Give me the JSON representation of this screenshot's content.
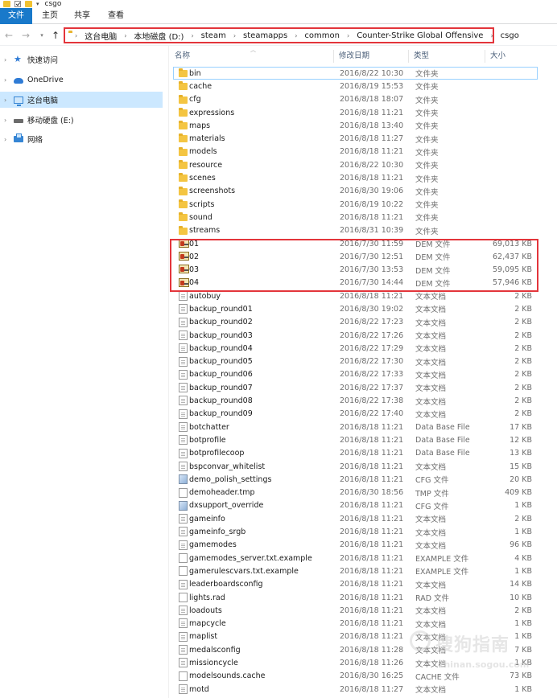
{
  "window": {
    "title": "csgo"
  },
  "ribbon": {
    "tabs": [
      "文件",
      "主页",
      "共享",
      "查看"
    ]
  },
  "address": {
    "crumbs": [
      "这台电脑",
      "本地磁盘 (D:)",
      "steam",
      "steamapps",
      "common",
      "Counter-Strike Global Offensive",
      "csgo"
    ]
  },
  "sidebar": {
    "items": [
      {
        "label": "快速访问",
        "icon": "quick-access-star-icon"
      },
      {
        "label": "OneDrive",
        "icon": "onedrive-cloud-icon"
      },
      {
        "label": "这台电脑",
        "icon": "this-pc-icon",
        "selected": true
      },
      {
        "label": "移动硬盘 (E:)",
        "icon": "removable-drive-icon"
      },
      {
        "label": "网络",
        "icon": "network-icon"
      }
    ]
  },
  "columns": {
    "name": "名称",
    "date": "修改日期",
    "type": "类型",
    "size": "大小"
  },
  "files": [
    {
      "name": "bin",
      "date": "2016/8/22 10:30",
      "type": "文件夹",
      "size": "",
      "icon": "folder"
    },
    {
      "name": "cache",
      "date": "2016/8/19 15:53",
      "type": "文件夹",
      "size": "",
      "icon": "folder"
    },
    {
      "name": "cfg",
      "date": "2016/8/18 18:07",
      "type": "文件夹",
      "size": "",
      "icon": "folder"
    },
    {
      "name": "expressions",
      "date": "2016/8/18 11:21",
      "type": "文件夹",
      "size": "",
      "icon": "folder"
    },
    {
      "name": "maps",
      "date": "2016/8/18 13:40",
      "type": "文件夹",
      "size": "",
      "icon": "folder"
    },
    {
      "name": "materials",
      "date": "2016/8/18 11:27",
      "type": "文件夹",
      "size": "",
      "icon": "folder"
    },
    {
      "name": "models",
      "date": "2016/8/18 11:21",
      "type": "文件夹",
      "size": "",
      "icon": "folder"
    },
    {
      "name": "resource",
      "date": "2016/8/22 10:30",
      "type": "文件夹",
      "size": "",
      "icon": "folder"
    },
    {
      "name": "scenes",
      "date": "2016/8/18 11:21",
      "type": "文件夹",
      "size": "",
      "icon": "folder"
    },
    {
      "name": "screenshots",
      "date": "2016/8/30 19:06",
      "type": "文件夹",
      "size": "",
      "icon": "folder"
    },
    {
      "name": "scripts",
      "date": "2016/8/19 10:22",
      "type": "文件夹",
      "size": "",
      "icon": "folder"
    },
    {
      "name": "sound",
      "date": "2016/8/18 11:21",
      "type": "文件夹",
      "size": "",
      "icon": "folder"
    },
    {
      "name": "streams",
      "date": "2016/8/31 10:39",
      "type": "文件夹",
      "size": "",
      "icon": "folder"
    },
    {
      "name": "01",
      "date": "2016/7/30 11:59",
      "type": "DEM 文件",
      "size": "69,013 KB",
      "icon": "dem"
    },
    {
      "name": "02",
      "date": "2016/7/30 12:51",
      "type": "DEM 文件",
      "size": "62,437 KB",
      "icon": "dem"
    },
    {
      "name": "03",
      "date": "2016/7/30 13:53",
      "type": "DEM 文件",
      "size": "59,095 KB",
      "icon": "dem"
    },
    {
      "name": "04",
      "date": "2016/7/30 14:44",
      "type": "DEM 文件",
      "size": "57,946 KB",
      "icon": "dem"
    },
    {
      "name": "autobuy",
      "date": "2016/8/18 11:21",
      "type": "文本文档",
      "size": "2 KB",
      "icon": "file"
    },
    {
      "name": "backup_round01",
      "date": "2016/8/30 19:02",
      "type": "文本文档",
      "size": "2 KB",
      "icon": "file"
    },
    {
      "name": "backup_round02",
      "date": "2016/8/22 17:23",
      "type": "文本文档",
      "size": "2 KB",
      "icon": "file"
    },
    {
      "name": "backup_round03",
      "date": "2016/8/22 17:26",
      "type": "文本文档",
      "size": "2 KB",
      "icon": "file"
    },
    {
      "name": "backup_round04",
      "date": "2016/8/22 17:29",
      "type": "文本文档",
      "size": "2 KB",
      "icon": "file"
    },
    {
      "name": "backup_round05",
      "date": "2016/8/22 17:30",
      "type": "文本文档",
      "size": "2 KB",
      "icon": "file"
    },
    {
      "name": "backup_round06",
      "date": "2016/8/22 17:33",
      "type": "文本文档",
      "size": "2 KB",
      "icon": "file"
    },
    {
      "name": "backup_round07",
      "date": "2016/8/22 17:37",
      "type": "文本文档",
      "size": "2 KB",
      "icon": "file"
    },
    {
      "name": "backup_round08",
      "date": "2016/8/22 17:38",
      "type": "文本文档",
      "size": "2 KB",
      "icon": "file"
    },
    {
      "name": "backup_round09",
      "date": "2016/8/22 17:40",
      "type": "文本文档",
      "size": "2 KB",
      "icon": "file"
    },
    {
      "name": "botchatter",
      "date": "2016/8/18 11:21",
      "type": "Data Base File",
      "size": "17 KB",
      "icon": "file"
    },
    {
      "name": "botprofile",
      "date": "2016/8/18 11:21",
      "type": "Data Base File",
      "size": "12 KB",
      "icon": "file"
    },
    {
      "name": "botprofilecoop",
      "date": "2016/8/18 11:21",
      "type": "Data Base File",
      "size": "13 KB",
      "icon": "file"
    },
    {
      "name": "bspconvar_whitelist",
      "date": "2016/8/18 11:21",
      "type": "文本文档",
      "size": "15 KB",
      "icon": "file"
    },
    {
      "name": "demo_polish_settings",
      "date": "2016/8/18 11:21",
      "type": "CFG 文件",
      "size": "20 KB",
      "icon": "cfg"
    },
    {
      "name": "demoheader.tmp",
      "date": "2016/8/30 18:56",
      "type": "TMP 文件",
      "size": "409 KB",
      "icon": "blank"
    },
    {
      "name": "dxsupport_override",
      "date": "2016/8/18 11:21",
      "type": "CFG 文件",
      "size": "1 KB",
      "icon": "cfg"
    },
    {
      "name": "gameinfo",
      "date": "2016/8/18 11:21",
      "type": "文本文档",
      "size": "2 KB",
      "icon": "file"
    },
    {
      "name": "gameinfo_srgb",
      "date": "2016/8/18 11:21",
      "type": "文本文档",
      "size": "1 KB",
      "icon": "file"
    },
    {
      "name": "gamemodes",
      "date": "2016/8/18 11:21",
      "type": "文本文档",
      "size": "96 KB",
      "icon": "file"
    },
    {
      "name": "gamemodes_server.txt.example",
      "date": "2016/8/18 11:21",
      "type": "EXAMPLE 文件",
      "size": "4 KB",
      "icon": "blank"
    },
    {
      "name": "gamerulescvars.txt.example",
      "date": "2016/8/18 11:21",
      "type": "EXAMPLE 文件",
      "size": "1 KB",
      "icon": "blank"
    },
    {
      "name": "leaderboardsconfig",
      "date": "2016/8/18 11:21",
      "type": "文本文档",
      "size": "14 KB",
      "icon": "file"
    },
    {
      "name": "lights.rad",
      "date": "2016/8/18 11:21",
      "type": "RAD 文件",
      "size": "10 KB",
      "icon": "blank"
    },
    {
      "name": "loadouts",
      "date": "2016/8/18 11:21",
      "type": "文本文档",
      "size": "2 KB",
      "icon": "file"
    },
    {
      "name": "mapcycle",
      "date": "2016/8/18 11:21",
      "type": "文本文档",
      "size": "1 KB",
      "icon": "file"
    },
    {
      "name": "maplist",
      "date": "2016/8/18 11:21",
      "type": "文本文档",
      "size": "1 KB",
      "icon": "file"
    },
    {
      "name": "medalsconfig",
      "date": "2016/8/18 11:28",
      "type": "文本文档",
      "size": "7 KB",
      "icon": "file"
    },
    {
      "name": "missioncycle",
      "date": "2016/8/18 11:26",
      "type": "文本文档",
      "size": "1 KB",
      "icon": "file"
    },
    {
      "name": "modelsounds.cache",
      "date": "2016/8/30 16:25",
      "type": "CACHE 文件",
      "size": "73 KB",
      "icon": "blank"
    },
    {
      "name": "motd",
      "date": "2016/8/18 11:27",
      "type": "文本文档",
      "size": "1 KB",
      "icon": "file"
    }
  ],
  "watermark": {
    "text": "搜狗指南",
    "url": "zhinan.sogou.com"
  }
}
